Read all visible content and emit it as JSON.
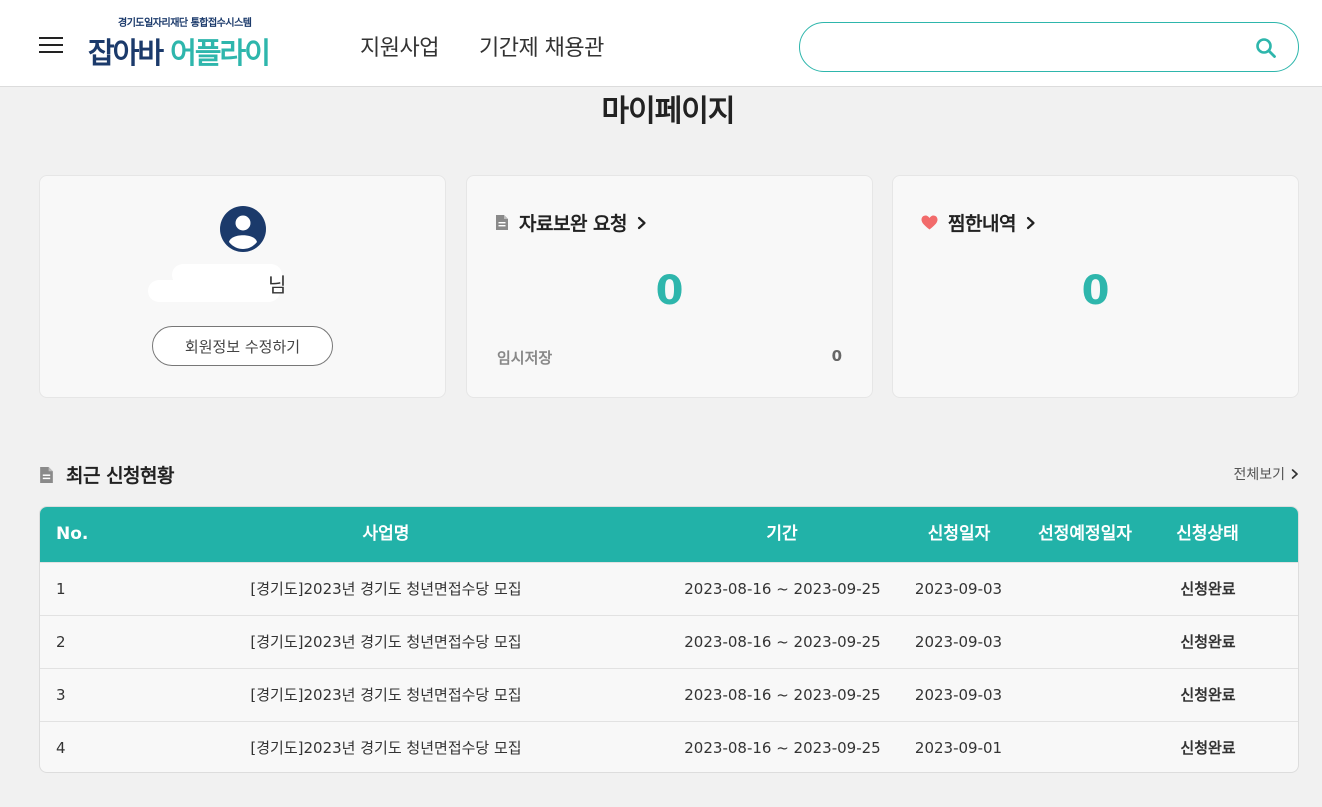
{
  "header": {
    "logo_sub": "경기도일자리재단 통합접수시스템",
    "logo_main_part1": "잡아바",
    "logo_main_part2": "어플라이",
    "nav": [
      "지원사업",
      "기간제 채용관"
    ],
    "search": {
      "value": "",
      "placeholder": ""
    }
  },
  "page_title": "마이페이지",
  "profile": {
    "name_suffix": "님",
    "edit_button": "회원정보 수정하기"
  },
  "supplement": {
    "title": "자료보완 요청",
    "count": "0",
    "temp_label": "임시저장",
    "temp_count": "0"
  },
  "favorites": {
    "title": "찜한내역",
    "count": "0"
  },
  "recent": {
    "title": "최근 신청현황",
    "view_all": "전체보기",
    "columns": [
      "No.",
      "사업명",
      "기간",
      "신청일자",
      "선정예정일자",
      "신청상태"
    ],
    "rows": [
      {
        "no": "1",
        "name": "[경기도]2023년 경기도 청년면접수당 모집",
        "period": "2023-08-16 ~ 2023-09-25",
        "date": "2023-09-03",
        "selection": "",
        "status": "신청완료"
      },
      {
        "no": "2",
        "name": "[경기도]2023년 경기도 청년면접수당 모집",
        "period": "2023-08-16 ~ 2023-09-25",
        "date": "2023-09-03",
        "selection": "",
        "status": "신청완료"
      },
      {
        "no": "3",
        "name": "[경기도]2023년 경기도 청년면접수당 모집",
        "period": "2023-08-16 ~ 2023-09-25",
        "date": "2023-09-03",
        "selection": "",
        "status": "신청완료"
      },
      {
        "no": "4",
        "name": "[경기도]2023년 경기도 청년면접수당 모집",
        "period": "2023-08-16 ~ 2023-09-25",
        "date": "2023-09-01",
        "selection": "",
        "status": "신청완료"
      }
    ]
  },
  "icons": {
    "menu": "menu-icon",
    "search": "search-icon",
    "avatar": "user-avatar-icon",
    "document": "document-icon",
    "heart": "heart-icon",
    "chevron": "chevron-right-icon"
  },
  "colors": {
    "accent": "#2eb6ac",
    "table_header": "#22b2a8",
    "brand_navy": "#1b3a6b",
    "heart": "#f26b6b"
  }
}
